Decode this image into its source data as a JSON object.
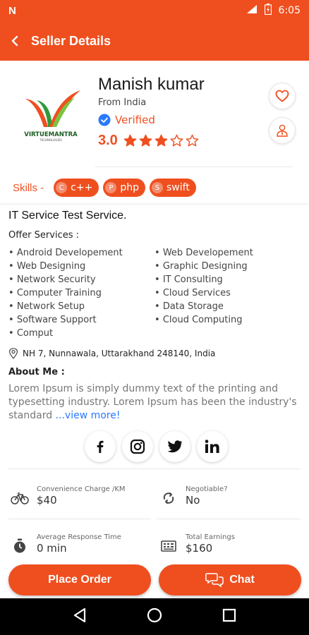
{
  "status_bar": {
    "time": "6:05",
    "network": "E"
  },
  "app_bar": {
    "title": "Seller Details"
  },
  "profile": {
    "name": "Manish kumar",
    "from": "From India",
    "verified": "Verified",
    "rating": "3.0",
    "rating_value": 3,
    "rating_max": 5,
    "logo_text": "VIRTUEMANTRA",
    "logo_subtext": "TECHNOLOGIES"
  },
  "skills": {
    "label": "Skills -",
    "items": [
      {
        "initial": "C",
        "name": "c++"
      },
      {
        "initial": "P",
        "name": "php"
      },
      {
        "initial": "S",
        "name": "swift"
      }
    ]
  },
  "service": {
    "title": "IT Service Test Service.",
    "offer_label": "Offer Services :",
    "col1": [
      "Android Developement",
      "Web Designing",
      "Network Security",
      "Computer Training",
      "Network Setup",
      "Software Support",
      "Comput"
    ],
    "col2": [
      "Web Developement",
      "Graphic Designing",
      "IT Consulting",
      "Cloud Services",
      "Data Storage",
      "Cloud Computing"
    ]
  },
  "address": "NH 7, Nunnawala, Uttarakhand 248140, India",
  "about": {
    "label": "About Me :",
    "text": "Lorem Ipsum is simply dummy text of the printing and typesetting industry. Lorem Ipsum has been the industry's standard",
    "view_more": "...view more!"
  },
  "info": {
    "convenience_label": "Convenience Charge /KM",
    "convenience_value": "$40",
    "negotiable_label": "Negotiable?",
    "negotiable_value": "No",
    "response_label": "Average Response Time",
    "response_value": "0 min",
    "earnings_label": "Total Earnings",
    "earnings_value": "$160"
  },
  "buttons": {
    "place_order": "Place Order",
    "chat": "Chat"
  },
  "colors": {
    "accent": "#ef4f1f",
    "link": "#2979ff"
  }
}
